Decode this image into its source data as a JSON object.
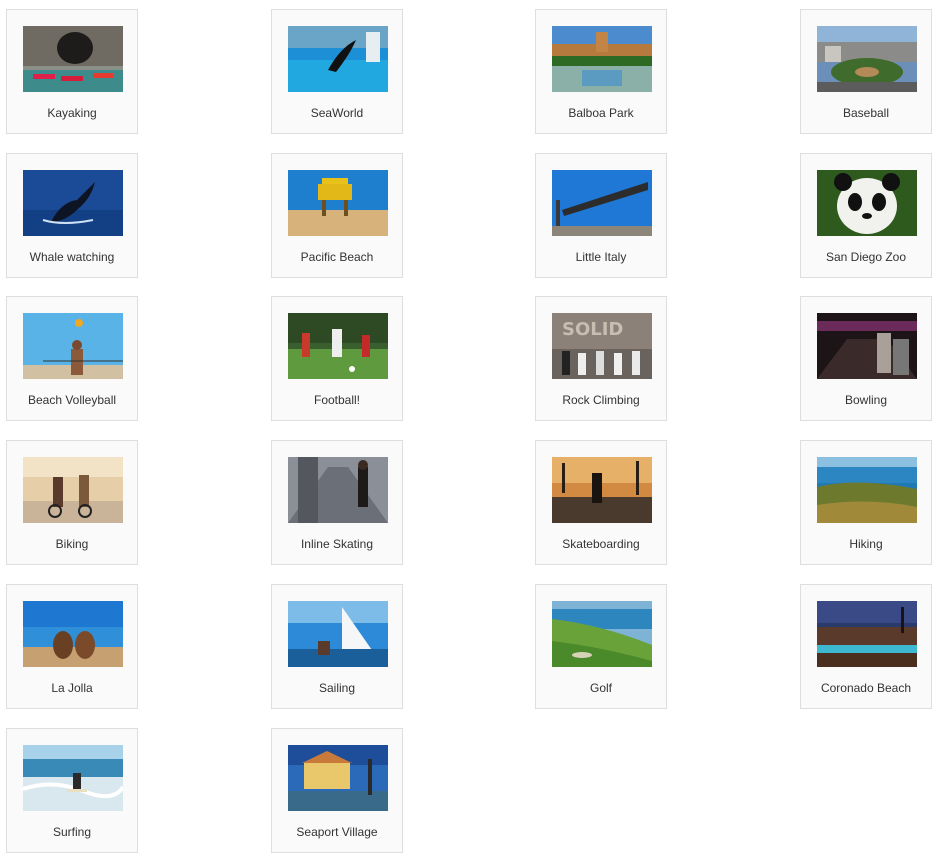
{
  "tiles": [
    {
      "label": "Kayaking",
      "image": "kayaking-photo"
    },
    {
      "label": "SeaWorld",
      "image": "seaworld-photo"
    },
    {
      "label": "Balboa Park",
      "image": "balboa-park-photo"
    },
    {
      "label": "Baseball",
      "image": "baseball-photo"
    },
    {
      "label": "Whale watching",
      "image": "whale-watching-photo"
    },
    {
      "label": "Pacific Beach",
      "image": "pacific-beach-photo"
    },
    {
      "label": "Little Italy",
      "image": "little-italy-photo"
    },
    {
      "label": "San Diego Zoo",
      "image": "san-diego-zoo-photo"
    },
    {
      "label": "Beach Volleyball",
      "image": "beach-volleyball-photo"
    },
    {
      "label": "Football!",
      "image": "football-photo"
    },
    {
      "label": "Rock Climbing",
      "image": "rock-climbing-photo"
    },
    {
      "label": "Bowling",
      "image": "bowling-photo"
    },
    {
      "label": "Biking",
      "image": "biking-photo"
    },
    {
      "label": "Inline Skating",
      "image": "inline-skating-photo"
    },
    {
      "label": "Skateboarding",
      "image": "skateboarding-photo"
    },
    {
      "label": "Hiking",
      "image": "hiking-photo"
    },
    {
      "label": "La Jolla",
      "image": "la-jolla-photo"
    },
    {
      "label": "Sailing",
      "image": "sailing-photo"
    },
    {
      "label": "Golf",
      "image": "golf-photo"
    },
    {
      "label": "Coronado Beach",
      "image": "coronado-beach-photo"
    },
    {
      "label": "Surfing",
      "image": "surfing-photo"
    },
    {
      "label": "Seaport Village",
      "image": "seaport-village-photo"
    }
  ],
  "colors": {
    "card_border": "#dedede",
    "card_background": "#fafafa",
    "label_text": "#333333"
  }
}
